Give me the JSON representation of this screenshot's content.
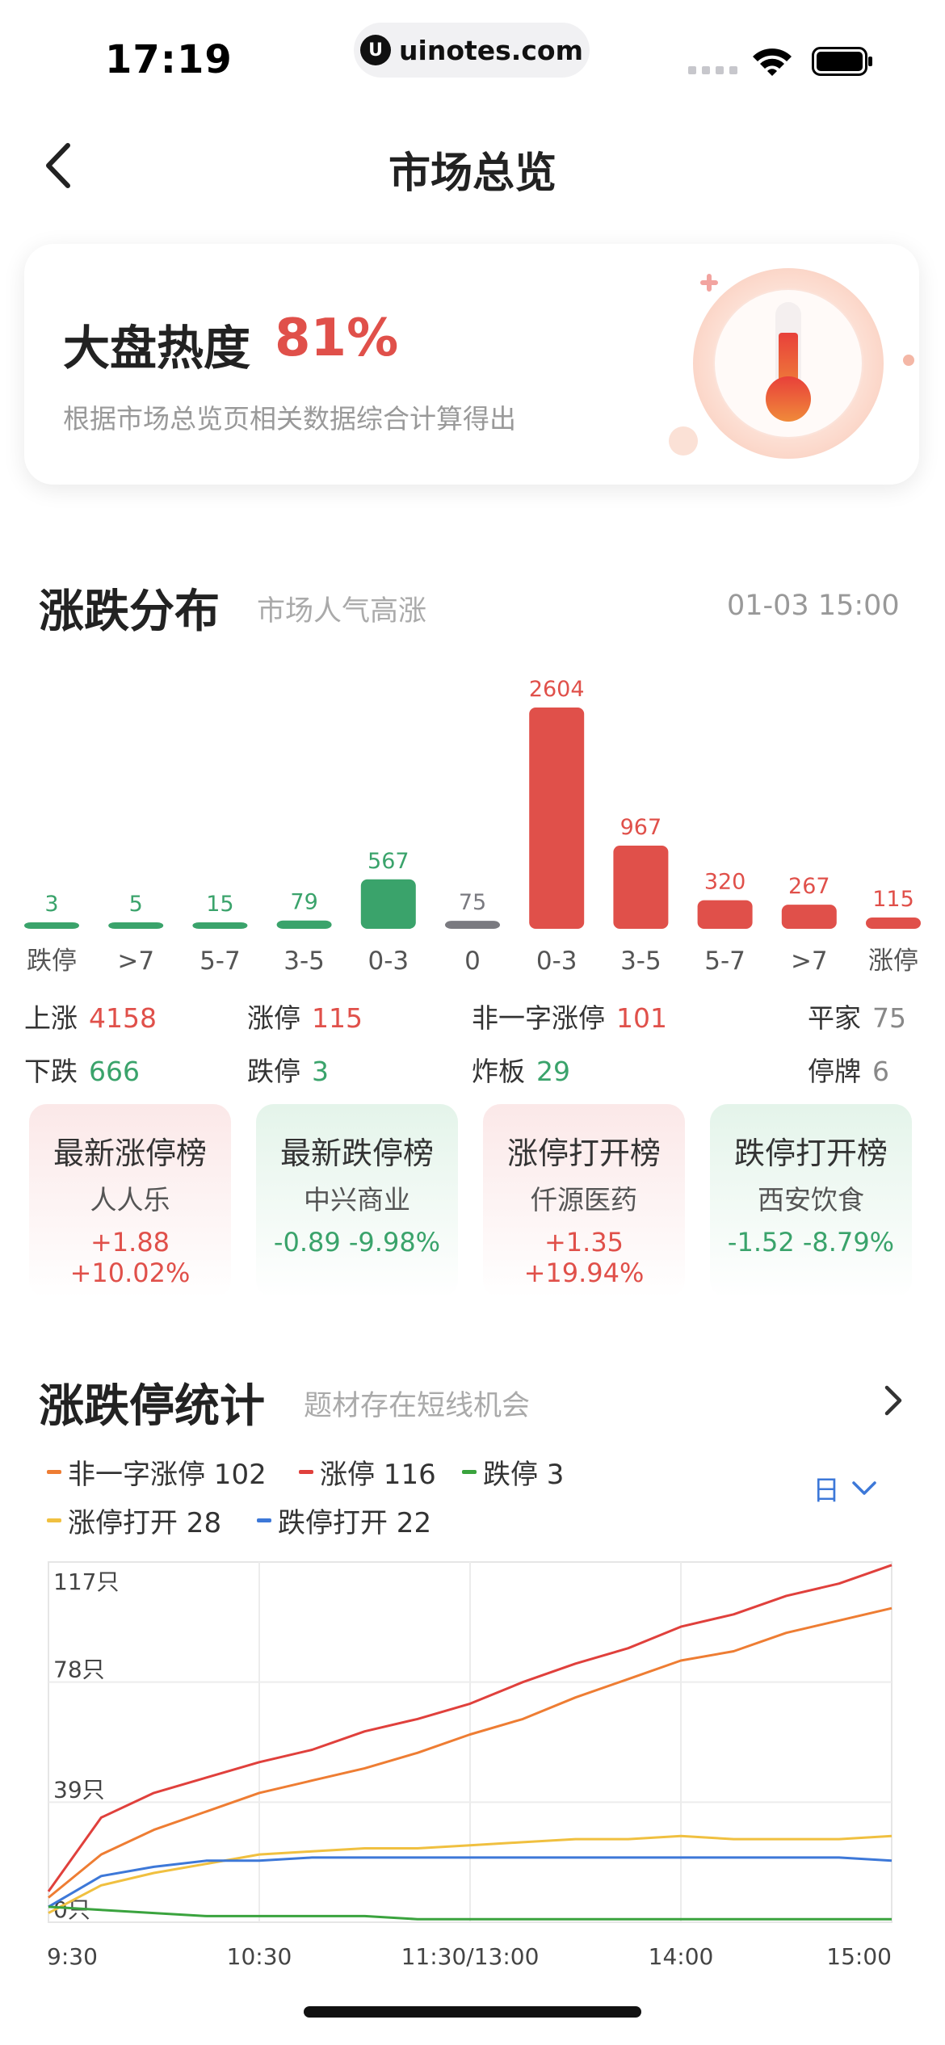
{
  "status_bar": {
    "time": "17:19",
    "url": "uinotes.com"
  },
  "nav": {
    "title": "市场总览"
  },
  "heat": {
    "title": "大盘热度",
    "value": "81%",
    "subtitle": "根据市场总览页相关数据综合计算得出"
  },
  "distribution": {
    "title": "涨跌分布",
    "subtitle": "市场人气高涨",
    "time": "01-03 15:00"
  },
  "summary": {
    "rise_label": "上涨",
    "rise_value": "4158",
    "limit_up_label": "涨停",
    "limit_up_value": "115",
    "non_oneword_label": "非一字涨停",
    "non_oneword_value": "101",
    "flat_label": "平家",
    "flat_value": "75",
    "fall_label": "下跌",
    "fall_value": "666",
    "limit_down_label": "跌停",
    "limit_down_value": "3",
    "broken_label": "炸板",
    "broken_value": "29",
    "suspended_label": "停牌",
    "suspended_value": "6"
  },
  "rank_cards": [
    {
      "title": "最新涨停榜",
      "stock": "人人乐",
      "change": "+1.88 +10.02%",
      "tone": "up"
    },
    {
      "title": "最新跌停榜",
      "stock": "中兴商业",
      "change": "-0.89 -9.98%",
      "tone": "down"
    },
    {
      "title": "涨停打开榜",
      "stock": "仟源医药",
      "change": "+1.35 +19.94%",
      "tone": "up"
    },
    {
      "title": "跌停打开榜",
      "stock": "西安饮食",
      "change": "-1.52 -8.79%",
      "tone": "down"
    }
  ],
  "stats": {
    "title": "涨跌停统计",
    "subtitle": "题材存在短线机会",
    "period": "日",
    "legend": [
      {
        "label": "非一字涨停 102",
        "color": "#ee7d33"
      },
      {
        "label": "涨停 116",
        "color": "#e0403c"
      },
      {
        "label": "跌停 3",
        "color": "#3aa33e"
      },
      {
        "label": "涨停打开 28",
        "color": "#f0c040"
      },
      {
        "label": "跌停打开 22",
        "color": "#3d78d8"
      }
    ]
  },
  "chart_data": [
    {
      "type": "bar",
      "categories": [
        "跌停",
        ">7",
        "5-7",
        "3-5",
        "0-3",
        "0",
        "0-3",
        "3-5",
        "5-7",
        ">7",
        "涨停"
      ],
      "values": [
        3,
        5,
        15,
        79,
        567,
        75,
        2604,
        967,
        320,
        267,
        115
      ],
      "colors": [
        "#3aa36b",
        "#3aa36b",
        "#3aa36b",
        "#3aa36b",
        "#3aa36b",
        "#7a7a80",
        "#e0504a",
        "#e0504a",
        "#e0504a",
        "#e0504a",
        "#e0504a"
      ],
      "ylim": [
        0,
        2604
      ]
    },
    {
      "type": "line",
      "x_ticks": [
        "9:30",
        "10:30",
        "11:30/13:00",
        "14:00",
        "15:00"
      ],
      "y_ticks": [
        "117只",
        "78只",
        "39只",
        "0只"
      ],
      "ylim": [
        0,
        117
      ],
      "grid": true,
      "x": [
        0,
        1,
        2,
        3,
        4,
        5,
        6,
        7,
        8,
        9,
        10,
        11,
        12,
        13,
        14,
        15,
        16
      ],
      "series": [
        {
          "name": "涨停",
          "color": "#e0403c",
          "values": [
            10,
            34,
            42,
            47,
            52,
            56,
            62,
            66,
            71,
            78,
            84,
            89,
            96,
            100,
            106,
            110,
            116
          ]
        },
        {
          "name": "非一字涨停",
          "color": "#ee7d33",
          "values": [
            8,
            22,
            30,
            36,
            42,
            46,
            50,
            55,
            61,
            66,
            73,
            79,
            85,
            88,
            94,
            98,
            102
          ]
        },
        {
          "name": "涨停打开",
          "color": "#f0c040",
          "values": [
            3,
            12,
            16,
            19,
            22,
            23,
            24,
            24,
            25,
            26,
            27,
            27,
            28,
            27,
            27,
            27,
            28
          ]
        },
        {
          "name": "跌停打开",
          "color": "#3d78d8",
          "values": [
            5,
            15,
            18,
            20,
            20,
            21,
            21,
            21,
            21,
            21,
            21,
            21,
            21,
            21,
            21,
            21,
            20
          ]
        },
        {
          "name": "跌停",
          "color": "#3aa33e",
          "values": [
            5,
            4,
            3,
            2,
            2,
            2,
            2,
            1,
            1,
            1,
            1,
            1,
            1,
            1,
            1,
            1,
            1
          ]
        }
      ]
    }
  ]
}
